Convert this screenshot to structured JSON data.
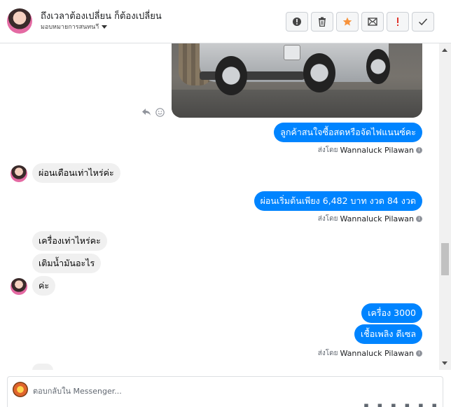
{
  "header": {
    "title": "ถึงเวลาต้องเปลี่ยน ก็ต้องเปลี่ยน",
    "assign_label": "มอบหมายการสนทนาี",
    "tools": [
      {
        "name": "mark-spam-button",
        "icon": "alert-circle-icon",
        "glyph": "!"
      },
      {
        "name": "delete-button",
        "icon": "trash-icon",
        "glyph": "🗑"
      },
      {
        "name": "star-button",
        "icon": "star-icon",
        "glyph": "★"
      },
      {
        "name": "mark-unread-button",
        "icon": "envelope-icon",
        "glyph": "✉"
      },
      {
        "name": "follow-up-button",
        "icon": "exclamation-icon",
        "glyph": "!"
      },
      {
        "name": "mark-done-button",
        "icon": "check-icon",
        "glyph": "✓"
      }
    ]
  },
  "thread": {
    "message_actions": {
      "reply_icon": "reply-icon",
      "react_icon": "smile-icon"
    },
    "messages": [
      {
        "dir": "out",
        "text": "ลูกค้าสนใจซื้อสดหรือจัดไฟแนนซ์คะ"
      },
      {
        "dir": "meta",
        "prefix": "ส่งโดย",
        "author": "Wannaluck Pilawan"
      },
      {
        "dir": "in",
        "text": "ผ่อนเดือนเท่าไหร่ค่ะ"
      },
      {
        "dir": "out",
        "text": "ผ่อนเริ่มต้นเพียง 6,482 บาท งวด 84 งวด"
      },
      {
        "dir": "meta",
        "prefix": "ส่งโดย",
        "author": "Wannaluck Pilawan"
      },
      {
        "dir": "in",
        "text": "เครื่องเท่าไหร่คะ"
      },
      {
        "dir": "in",
        "text": "เติมน้ำมันอะไร"
      },
      {
        "dir": "in",
        "text": "ค่ะ"
      },
      {
        "dir": "out",
        "text": "เครื่อง 3000"
      },
      {
        "dir": "out",
        "text": "เชื้อเพลิง ดีเซล"
      },
      {
        "dir": "meta",
        "prefix": "ส่งโดย",
        "author": "Wannaluck Pilawan"
      }
    ]
  },
  "composer": {
    "placeholder": "ตอบกลับใน Messenger...",
    "tools": [
      "attach-icon",
      "tag-icon",
      "gif-icon",
      "emoji-icon",
      "like-icon",
      "more-icon"
    ]
  },
  "colors": {
    "accent": "#0084ff",
    "incoming": "#f0f0f0",
    "star": "#f7923b",
    "alert": "#e0342c"
  }
}
